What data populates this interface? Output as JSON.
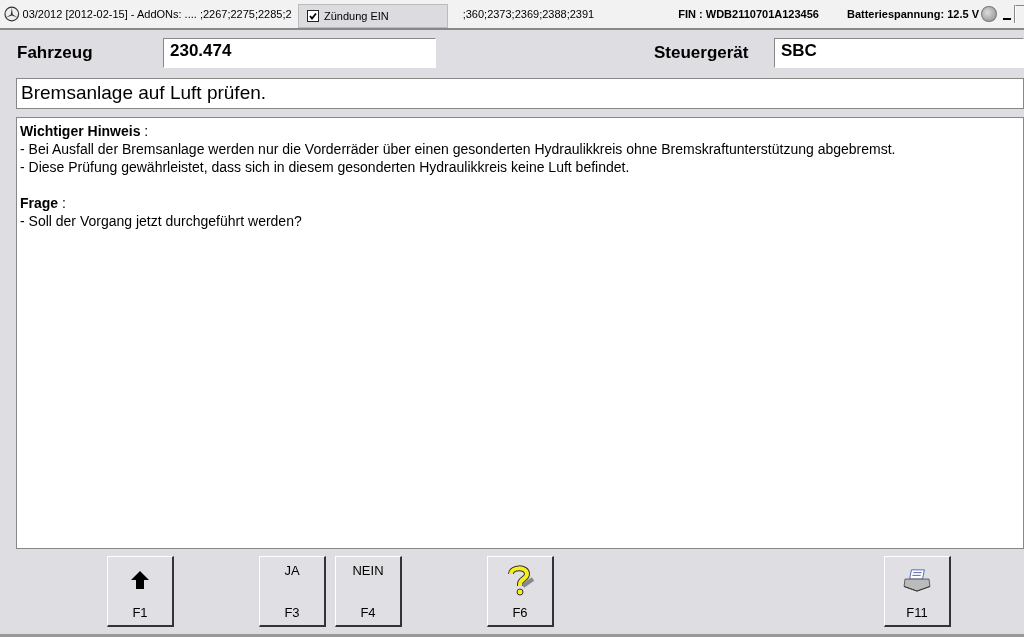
{
  "title_bar": {
    "version_text": "03/2012 [2012-02-15] - AddONs:  .... ;2267;2275;2285;2",
    "addons_text": ";360;2373;2369;2388;2391",
    "fin": "FIN : WDB2110701A123456",
    "battery": "Batteriespannung: 12.5 V"
  },
  "ignition_popup": {
    "label": "Zündung EIN",
    "checked": true
  },
  "vehicle": {
    "label": "Fahrzeug",
    "value": "230.474"
  },
  "control_unit": {
    "label": "Steuergerät",
    "value": "SBC"
  },
  "instruction": "Bremsanlage auf Luft prüfen.",
  "message": [
    {
      "kind": "heading",
      "text": "**Wichtiger Hinweis** :"
    },
    {
      "kind": "item",
      "text": "- Bei Ausfall der Bremsanlage werden nur die Vorderräder über einen gesonderten Hydraulikkreis ohne Bremskraftunterstützung abgebremst."
    },
    {
      "kind": "item",
      "text": "- Diese Prüfung gewährleistet, dass sich in diesem gesonderten Hydraulikkreis keine Luft befindet."
    },
    {
      "kind": "gap"
    },
    {
      "kind": "heading",
      "text": "**Frage** :"
    },
    {
      "kind": "item",
      "text": "- Soll der Vorgang jetzt durchgeführt werden?"
    }
  ],
  "buttons": [
    {
      "kind": "arrow",
      "key": "F1"
    },
    {
      "kind": "spacer"
    },
    {
      "kind": "text",
      "label": "JA",
      "key": "F3"
    },
    {
      "kind": "text",
      "label": "NEIN",
      "key": "F4"
    },
    {
      "kind": "spacer"
    },
    {
      "kind": "help",
      "key": "F6"
    },
    {
      "kind": "wide"
    },
    {
      "kind": "print",
      "key": "F11"
    }
  ]
}
